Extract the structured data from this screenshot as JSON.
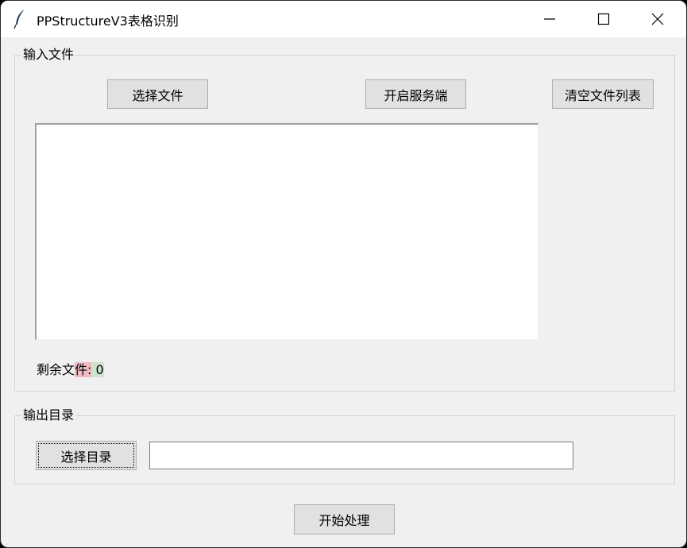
{
  "window": {
    "title": "PPStructureV3表格识别",
    "icon": "feather-icon",
    "controls": [
      "minimize-icon",
      "maximize-icon",
      "close-icon"
    ]
  },
  "input_group": {
    "label": "输入文件",
    "buttons": {
      "select_file": "选择文件",
      "start_server": "开启服务端",
      "clear_list": "清空文件列表"
    },
    "file_list": [],
    "remaining_prefix": "剩余文",
    "remaining_mid": "件",
    "remaining_colon": ":",
    "remaining_count": " 0"
  },
  "output_group": {
    "label": "输出目录",
    "select_dir": "选择目录",
    "dir_value": ""
  },
  "actions": {
    "start_processing": "开始处理"
  }
}
